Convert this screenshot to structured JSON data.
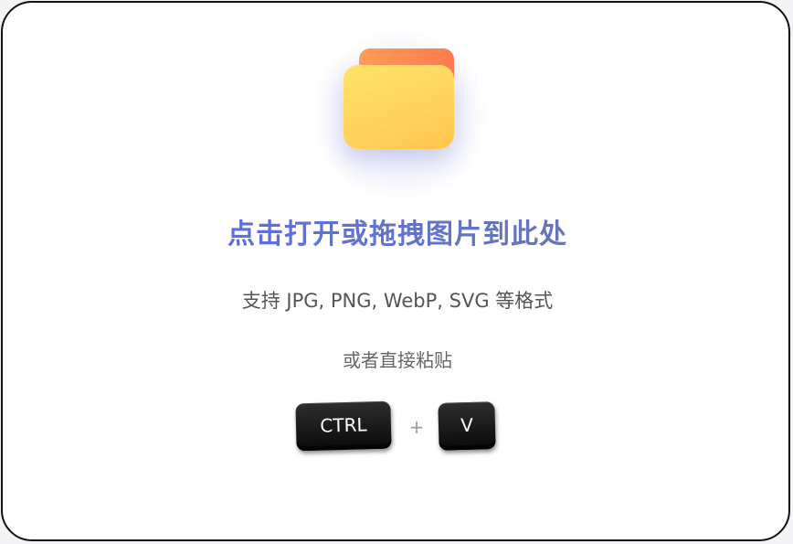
{
  "upload": {
    "icon": "folder-icon",
    "title": "点击打开或拖拽图片到此处",
    "formats": "支持 JPG, PNG, WebP, SVG 等格式",
    "paste_hint": "或者直接粘贴",
    "keys": {
      "ctrl": "CTRL",
      "plus": "+",
      "v": "V"
    }
  },
  "colors": {
    "title_gradient_start": "#5566e0",
    "title_gradient_end": "#6f7a96",
    "folder_back": "#ff8a50",
    "folder_front": "#ffd65c",
    "key_background": "#141414",
    "border": "#111111"
  }
}
